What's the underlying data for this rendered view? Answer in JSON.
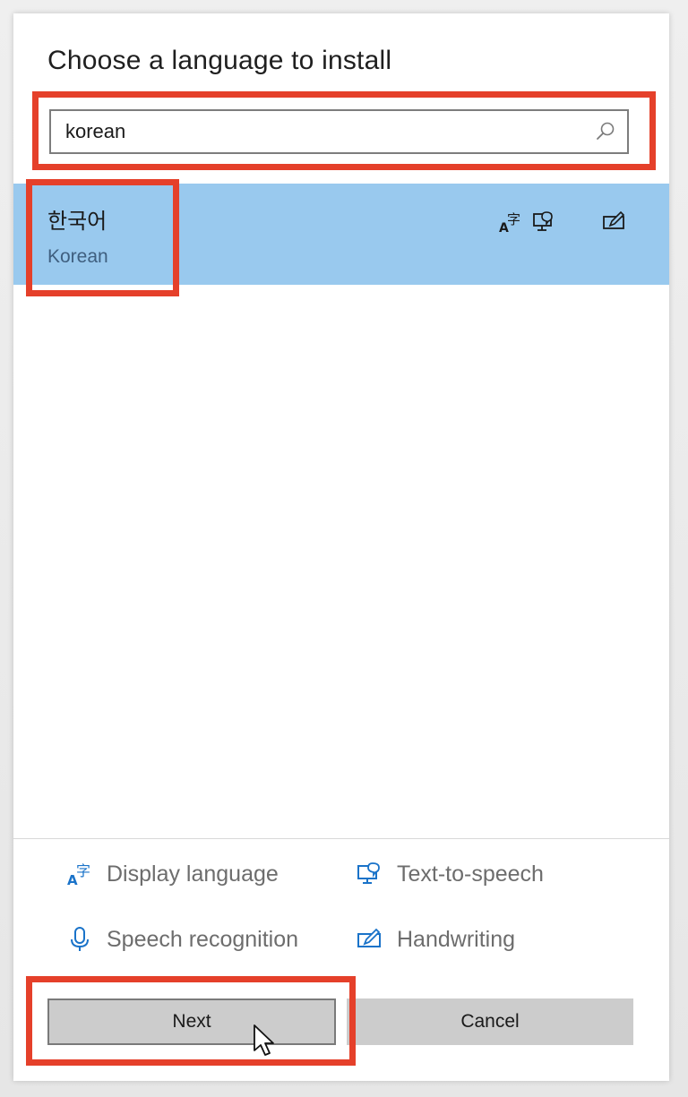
{
  "dialog": {
    "title": "Choose a language to install"
  },
  "search": {
    "value": "korean",
    "placeholder": ""
  },
  "results": [
    {
      "native_name": "한국어",
      "english_name": "Korean",
      "features": [
        "display-language-icon",
        "text-to-speech-icon",
        "handwriting-icon"
      ],
      "selected": true
    }
  ],
  "legend": {
    "display_language": "Display language",
    "text_to_speech": "Text-to-speech",
    "speech_recognition": "Speech recognition",
    "handwriting": "Handwriting"
  },
  "buttons": {
    "next": "Next",
    "cancel": "Cancel"
  },
  "colors": {
    "selection": "#99c9ee",
    "annotation": "#e5402a",
    "icon_blue": "#1a73c9"
  }
}
